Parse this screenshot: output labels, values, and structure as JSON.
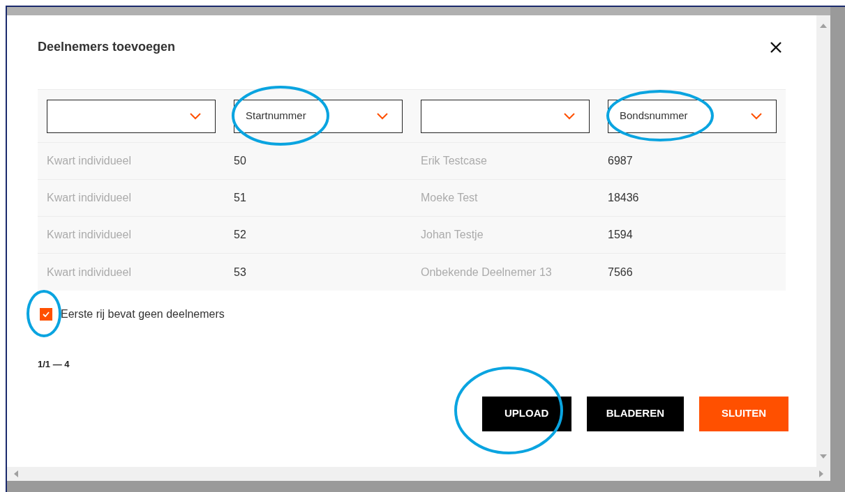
{
  "dialog": {
    "title": "Deelnemers toevoegen"
  },
  "table": {
    "columns": [
      {
        "disabled": true
      },
      {
        "field": "Startnummer",
        "disabled": false
      },
      {
        "disabled": true
      },
      {
        "field": "Bondsnummer",
        "disabled": false
      }
    ],
    "rows": [
      [
        "Kwart individueel",
        "50",
        "Erik Testcase",
        "6987"
      ],
      [
        "Kwart individueel",
        "51",
        "Moeke Test",
        "18436"
      ],
      [
        "Kwart individueel",
        "52",
        "Johan Testje",
        "1594"
      ],
      [
        "Kwart individueel",
        "53",
        "Onbekende Deelnemer 13",
        "7566"
      ]
    ]
  },
  "first_row_option": {
    "label": "Eerste rij bevat geen deelnemers",
    "checked": true
  },
  "pager": "1/1 — 4",
  "buttons": [
    {
      "label": "UPLOAD",
      "kind": "dark"
    },
    {
      "label": "BLADEREN",
      "kind": "dark"
    },
    {
      "label": "SLUITEN",
      "kind": "accent"
    }
  ]
}
